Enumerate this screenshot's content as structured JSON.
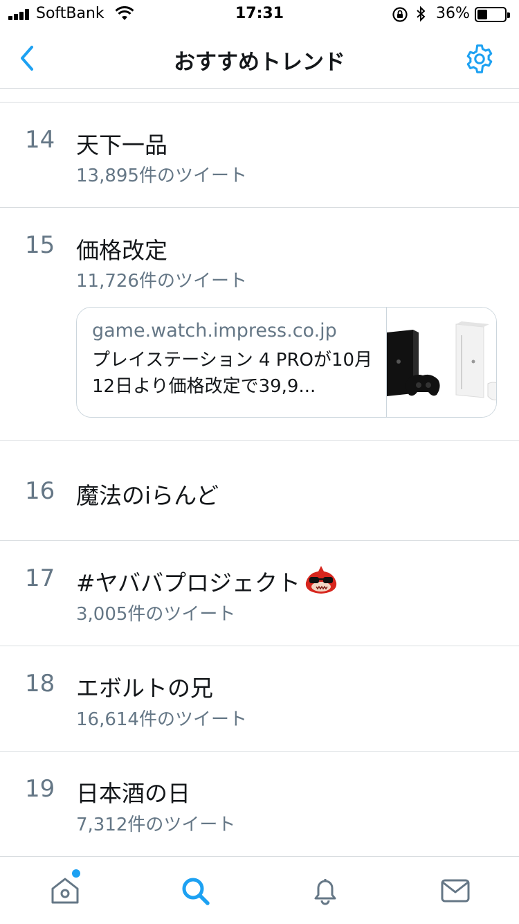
{
  "status_bar": {
    "carrier": "SoftBank",
    "time": "17:31",
    "battery_percent": "36%"
  },
  "nav": {
    "title": "おすすめトレンド"
  },
  "trends": [
    {
      "rank": "14",
      "name": "天下一品",
      "count": "13,895件のツイート"
    },
    {
      "rank": "15",
      "name": "価格改定",
      "count": "11,726件のツイート"
    },
    {
      "rank": "16",
      "name": "魔法のiらんど",
      "count": ""
    },
    {
      "rank": "17",
      "name": "#ヤババプロジェクト",
      "count": "3,005件のツイート"
    },
    {
      "rank": "18",
      "name": "エボルトの兄",
      "count": "16,614件のツイート"
    },
    {
      "rank": "19",
      "name": "日本酒の日",
      "count": "7,312件のツイート"
    }
  ],
  "card": {
    "domain": "game.watch.impress.co.jp",
    "description": "プレイステーション 4 PROが10月12日より価格改定で39,9..."
  },
  "tab_bar": {
    "items": [
      "home-icon",
      "search-icon",
      "notifications-icon",
      "messages-icon"
    ],
    "active": "search-icon"
  },
  "colors": {
    "accent": "#1da1f2",
    "secondary_text": "#657786",
    "primary_text": "#14171a",
    "divider": "#d9dde0"
  }
}
